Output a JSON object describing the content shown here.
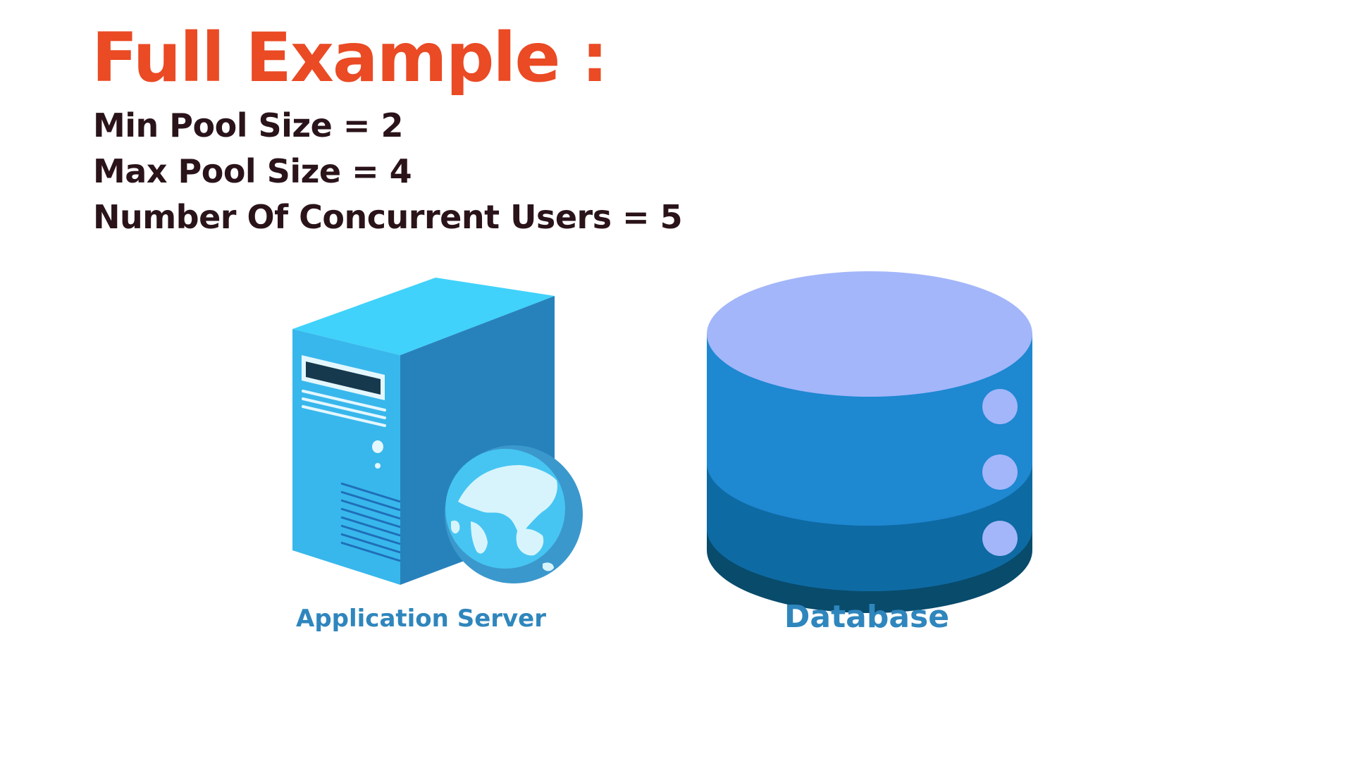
{
  "title": "Full Example :",
  "parameters": [
    {
      "text": "Min Pool Size = 2"
    },
    {
      "text": "Max Pool Size = 4"
    },
    {
      "text": "Number Of Concurrent Users = 5"
    }
  ],
  "nodes": {
    "server": {
      "label": "Application Server",
      "icon": "server-with-globe-icon"
    },
    "database": {
      "label": "Database",
      "icon": "database-cylinder-icon"
    }
  },
  "colors": {
    "title": "#ea4a24",
    "text": "#2a1419",
    "label": "#2f86bd",
    "server_top": "#40d2fa",
    "server_front": "#38b7ec",
    "server_side": "#2782bc",
    "db_top": "#a3b6fa",
    "db_band_1": "#1e88d1",
    "db_band_2": "#0e6aa3",
    "db_band_3": "#084b6b"
  }
}
